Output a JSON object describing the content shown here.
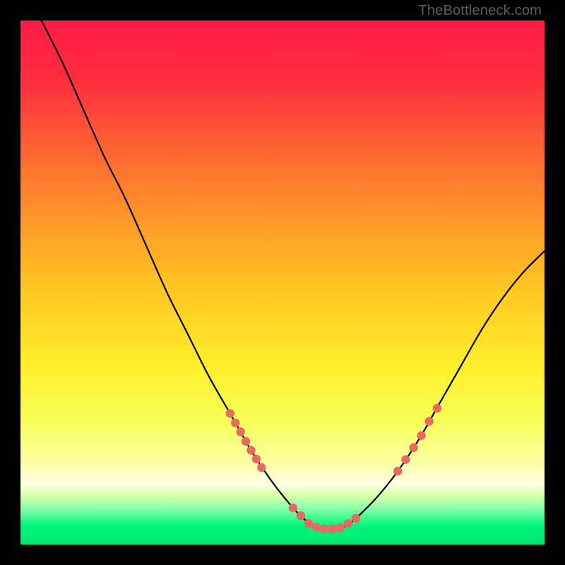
{
  "watermark": "TheBottleneck.com",
  "colors": {
    "background": "#000000",
    "gradient_top": "#ff1a46",
    "gradient_mid_upper": "#ff8a2a",
    "gradient_mid": "#ffe22a",
    "gradient_lower": "#f8ff60",
    "gradient_pale": "#fdffb0",
    "gradient_green": "#00f57a",
    "curve": "#000000",
    "marker": "#e86a63",
    "watermark": "#5d5d5d"
  },
  "chart_data": {
    "type": "line",
    "title": "",
    "xlabel": "",
    "ylabel": "",
    "xlim": [
      0,
      100
    ],
    "ylim": [
      0,
      100
    ],
    "grid": false,
    "legend": false,
    "series": [
      {
        "name": "bottleneck-curve",
        "x": [
          4,
          8,
          12,
          16,
          20,
          24,
          28,
          32,
          36,
          40,
          44,
          48,
          52,
          54,
          56,
          58,
          60,
          62,
          64,
          68,
          72,
          76,
          80,
          84,
          88,
          92,
          96,
          100
        ],
        "y": [
          100,
          92,
          83,
          74,
          66,
          57,
          48,
          40,
          32,
          25,
          18,
          12,
          7,
          5,
          3.5,
          3,
          3,
          3.5,
          5,
          9,
          14,
          20,
          27,
          34,
          41,
          47,
          52,
          56
        ]
      }
    ],
    "marker_clusters": [
      {
        "name": "left-cluster",
        "points": [
          {
            "x": 40,
            "y": 25
          },
          {
            "x": 41,
            "y": 23.2
          },
          {
            "x": 42,
            "y": 21.5
          },
          {
            "x": 43,
            "y": 19.7
          },
          {
            "x": 44,
            "y": 18
          },
          {
            "x": 45,
            "y": 16.3
          },
          {
            "x": 46,
            "y": 14.7
          }
        ]
      },
      {
        "name": "bottom-cluster",
        "points": [
          {
            "x": 52,
            "y": 7
          },
          {
            "x": 53.5,
            "y": 5.5
          },
          {
            "x": 55,
            "y": 4
          },
          {
            "x": 56.5,
            "y": 3.3
          },
          {
            "x": 58,
            "y": 3
          },
          {
            "x": 59.5,
            "y": 3
          },
          {
            "x": 61,
            "y": 3.2
          },
          {
            "x": 62.5,
            "y": 4
          },
          {
            "x": 64,
            "y": 5
          }
        ]
      },
      {
        "name": "right-cluster",
        "points": [
          {
            "x": 72,
            "y": 14
          },
          {
            "x": 73.5,
            "y": 16.2
          },
          {
            "x": 75,
            "y": 18.5
          },
          {
            "x": 76.5,
            "y": 20.8
          },
          {
            "x": 78,
            "y": 23.5
          },
          {
            "x": 79.5,
            "y": 26
          }
        ]
      }
    ]
  }
}
